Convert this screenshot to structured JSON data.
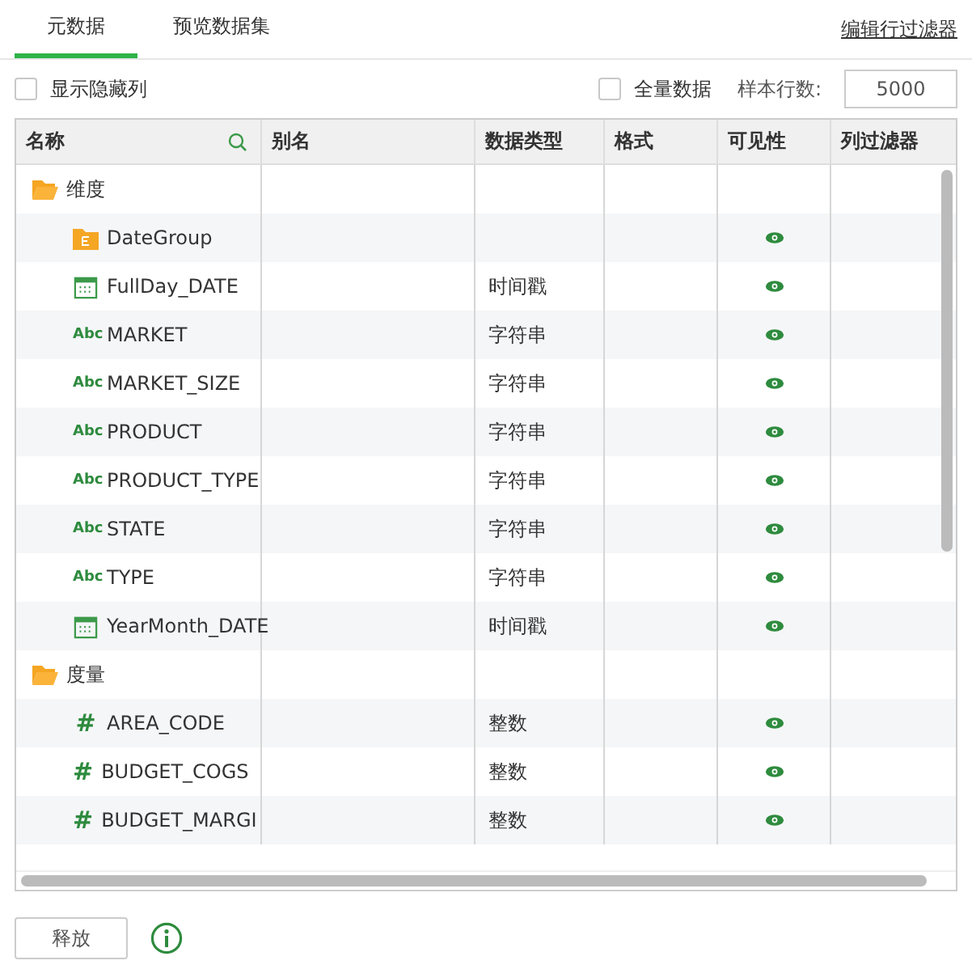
{
  "tabs": [
    {
      "label": "元数据",
      "selected": true
    },
    {
      "label": "预览数据集",
      "selected": false
    }
  ],
  "edit_filter_link": "编辑行过滤器",
  "show_hidden": {
    "label": "显示隐藏列",
    "checked": false
  },
  "full_data": {
    "label": "全量数据",
    "checked": false
  },
  "sample_rows": {
    "label": "样本行数:",
    "value": "5000"
  },
  "table": {
    "columns": [
      "名称",
      "别名",
      "数据类型",
      "格式",
      "可见性",
      "列过滤器"
    ],
    "rows": [
      {
        "kind": "folder",
        "name": "维度"
      },
      {
        "kind": "group",
        "name": "DateGroup",
        "type": "",
        "visible": true
      },
      {
        "kind": "date",
        "name": "FullDay_DATE",
        "type": "时间戳",
        "visible": true
      },
      {
        "kind": "string",
        "icon_text": "Abc",
        "name": "MARKET",
        "type": "字符串",
        "visible": true
      },
      {
        "kind": "string",
        "icon_text": "Abc",
        "name": "MARKET_SIZE",
        "type": "字符串",
        "visible": true
      },
      {
        "kind": "string",
        "icon_text": "Abc",
        "name": "PRODUCT",
        "type": "字符串",
        "visible": true
      },
      {
        "kind": "string",
        "icon_text": "Abc",
        "name": "PRODUCT_TYPE",
        "type": "字符串",
        "visible": true
      },
      {
        "kind": "string",
        "icon_text": "Abc",
        "name": "STATE",
        "type": "字符串",
        "visible": true
      },
      {
        "kind": "string",
        "icon_text": "Abc",
        "name": "TYPE",
        "type": "字符串",
        "visible": true
      },
      {
        "kind": "date",
        "name": "YearMonth_DATE",
        "type": "时间戳",
        "visible": true
      },
      {
        "kind": "folder",
        "name": "度量"
      },
      {
        "kind": "number",
        "icon_text": "#",
        "name": "AREA_CODE",
        "type": "整数",
        "visible": true
      },
      {
        "kind": "number",
        "icon_text": "#",
        "name": "BUDGET_COGS",
        "type": "整数",
        "visible": true
      },
      {
        "kind": "number",
        "icon_text": "#",
        "name": "BUDGET_MARGI",
        "type": "整数",
        "visible": true
      }
    ]
  },
  "release_button": "释放"
}
